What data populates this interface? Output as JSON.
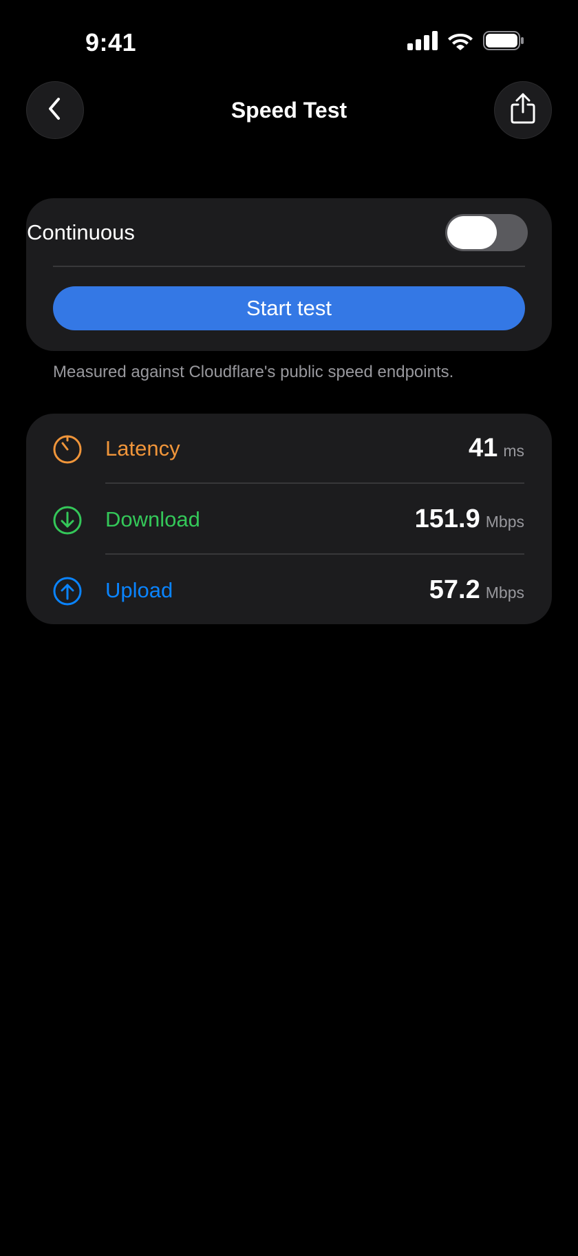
{
  "status_bar": {
    "time": "9:41",
    "icons": [
      "signal-icon",
      "wifi-icon",
      "battery-icon"
    ]
  },
  "nav": {
    "title": "Speed Test",
    "back_icon": "chevron-left-icon",
    "share_icon": "share-icon"
  },
  "controls": {
    "continuous_label": "Continuous",
    "continuous_on": false,
    "start_label": "Start test",
    "caption": "Measured against Cloudflare's public speed endpoints."
  },
  "metrics": [
    {
      "label": "Latency",
      "value": "41",
      "unit": "ms",
      "color": "#f0953a",
      "icon": "timer-icon"
    },
    {
      "label": "Download",
      "value": "151.9",
      "unit": "Mbps",
      "color": "#34c759",
      "icon": "arrow-down-circle-icon"
    },
    {
      "label": "Upload",
      "value": "57.2",
      "unit": "Mbps",
      "color": "#0a84ff",
      "icon": "arrow-up-circle-icon"
    }
  ],
  "colors": {
    "background": "#000000",
    "card": "#1c1c1e",
    "accent": "#3478e5",
    "secondary_text": "#98989d"
  }
}
